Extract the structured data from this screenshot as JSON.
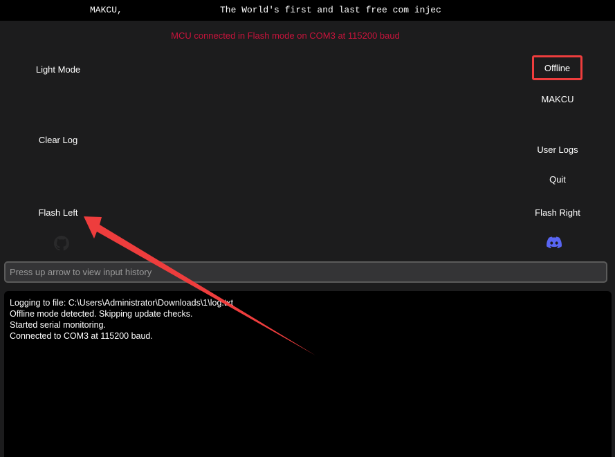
{
  "title": {
    "app_name": "MAKCU,",
    "tagline": "The World's first and last free com injec"
  },
  "status": {
    "text": "MCU connected in Flash mode on COM3 at 115200 baud",
    "color": "#c8143c"
  },
  "left_buttons": {
    "light_mode": "Light Mode",
    "clear_log": "Clear Log",
    "flash_left": "Flash Left"
  },
  "right_buttons": {
    "offline": "Offline",
    "makcu": "MAKCU",
    "user_logs": "User Logs",
    "quit": "Quit",
    "flash_right": "Flash Right"
  },
  "icons": {
    "github": "github-icon",
    "discord": "discord-icon"
  },
  "input": {
    "placeholder": "Press up arrow to view input history",
    "value": ""
  },
  "log": {
    "lines": [
      "Logging to file: C:\\Users\\Administrator\\Downloads\\1\\log.txt",
      "Offline mode detected. Skipping update checks.",
      "Started serial monitoring.",
      "Connected to COM3 at 115200 baud."
    ]
  },
  "colors": {
    "background": "#1c1c1d",
    "highlight": "#ee3d3d",
    "annotation_arrow": "#ee3d3d"
  }
}
